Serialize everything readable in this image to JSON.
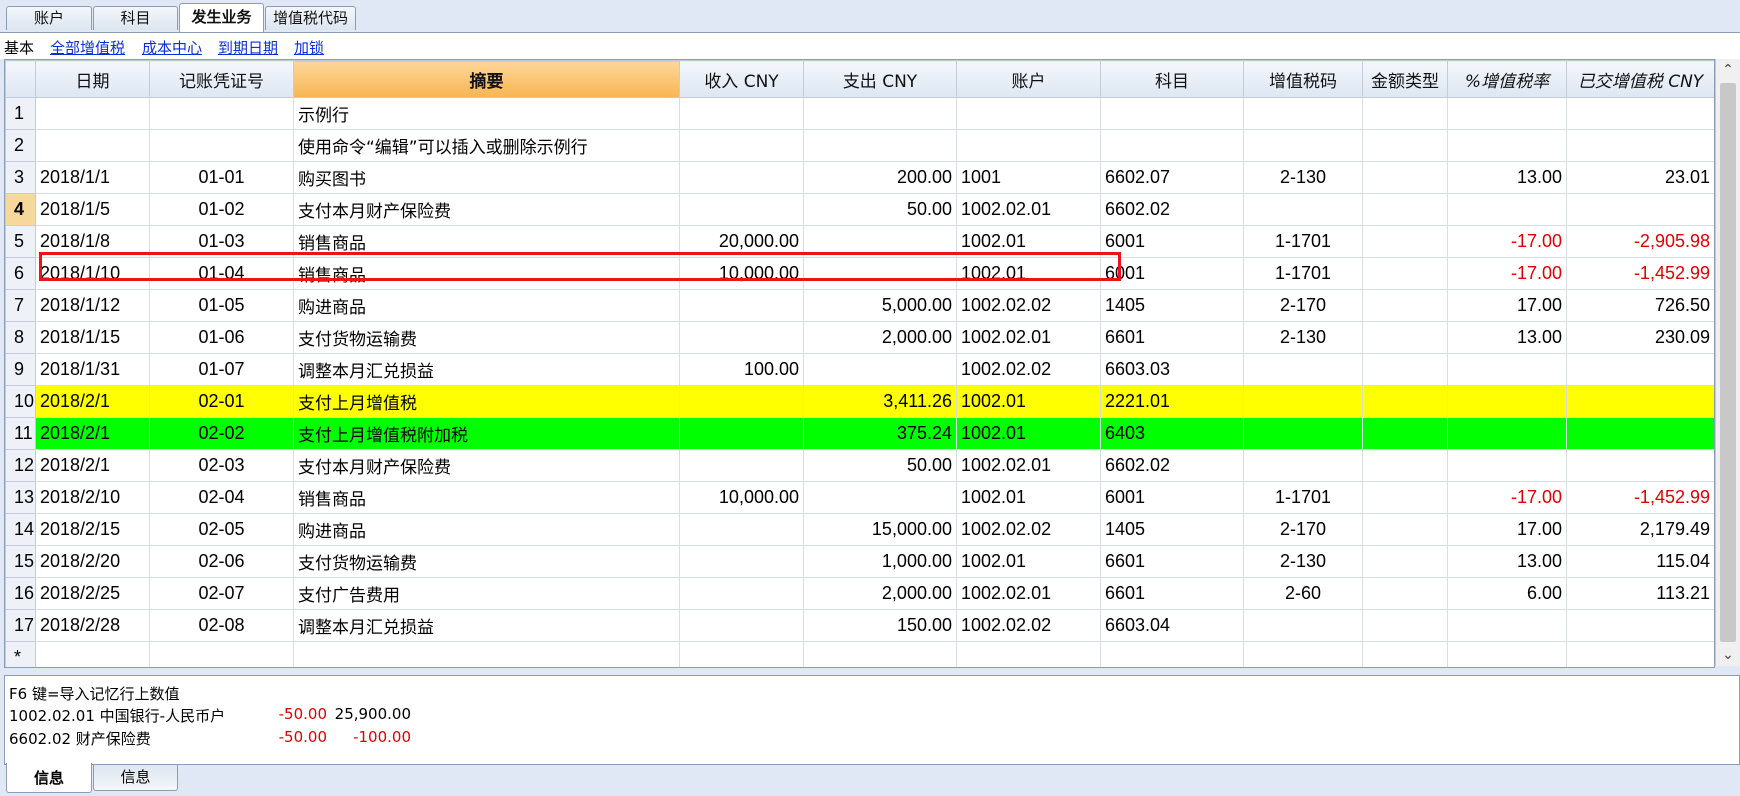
{
  "top_tabs": [
    "账户",
    "科目",
    "发生业务",
    "增值税代码"
  ],
  "views": [
    "基本",
    "全部增值税",
    "成本中心",
    "到期日期",
    "加锁"
  ],
  "columns": [
    "",
    "日期",
    "记账凭证号",
    "摘要",
    "收入 CNY",
    "支出 CNY",
    "账户",
    "科目",
    "增值税码",
    "金额类型",
    "%增值税率",
    "已交增值税 CNY"
  ],
  "rows": [
    {
      "n": "1",
      "date": "",
      "doc": "",
      "desc": "示例行",
      "income": "",
      "expense": "",
      "account": "",
      "subject": "",
      "vatcode": "",
      "amttype": "",
      "vatrate": "",
      "vatpaid": ""
    },
    {
      "n": "2",
      "date": "",
      "doc": "",
      "desc": "使用命令“编辑”可以插入或删除示例行",
      "income": "",
      "expense": "",
      "account": "",
      "subject": "",
      "vatcode": "",
      "amttype": "",
      "vatrate": "",
      "vatpaid": ""
    },
    {
      "n": "3",
      "date": "2018/1/1",
      "doc": "01-01",
      "desc": "购买图书",
      "income": "",
      "expense": "200.00",
      "account": "1001",
      "subject": "6602.07",
      "vatcode": "2-130",
      "amttype": "",
      "vatrate": "13.00",
      "vatpaid": "23.01"
    },
    {
      "n": "4",
      "date": "2018/1/5",
      "doc": "01-02",
      "desc": "支付本月财产保险费",
      "income": "",
      "expense": "50.00",
      "account": "1002.02.01",
      "subject": "6602.02",
      "vatcode": "",
      "amttype": "",
      "vatrate": "",
      "vatpaid": ""
    },
    {
      "n": "5",
      "date": "2018/1/8",
      "doc": "01-03",
      "desc": "销售商品",
      "income": "20,000.00",
      "expense": "",
      "account": "1002.01",
      "subject": "6001",
      "vatcode": "1-1701",
      "amttype": "",
      "vatrate": "-17.00",
      "vatpaid": "-2,905.98"
    },
    {
      "n": "6",
      "date": "2018/1/10",
      "doc": "01-04",
      "desc": "销售商品",
      "income": "10,000.00",
      "expense": "",
      "account": "1002.01",
      "subject": "6001",
      "vatcode": "1-1701",
      "amttype": "",
      "vatrate": "-17.00",
      "vatpaid": "-1,452.99"
    },
    {
      "n": "7",
      "date": "2018/1/12",
      "doc": "01-05",
      "desc": "购进商品",
      "income": "",
      "expense": "5,000.00",
      "account": "1002.02.02",
      "subject": "1405",
      "vatcode": "2-170",
      "amttype": "",
      "vatrate": "17.00",
      "vatpaid": "726.50"
    },
    {
      "n": "8",
      "date": "2018/1/15",
      "doc": "01-06",
      "desc": "支付货物运输费",
      "income": "",
      "expense": "2,000.00",
      "account": "1002.02.01",
      "subject": "6601",
      "vatcode": "2-130",
      "amttype": "",
      "vatrate": "13.00",
      "vatpaid": "230.09"
    },
    {
      "n": "9",
      "date": "2018/1/31",
      "doc": "01-07",
      "desc": "调整本月汇兑损益",
      "income": "100.00",
      "expense": "",
      "account": "1002.02.02",
      "subject": "6603.03",
      "vatcode": "",
      "amttype": "",
      "vatrate": "",
      "vatpaid": ""
    },
    {
      "n": "10",
      "date": "2018/2/1",
      "doc": "02-01",
      "desc": "支付上月增值税",
      "income": "",
      "expense": "3,411.26",
      "account": "1002.01",
      "subject": "2221.01",
      "vatcode": "",
      "amttype": "",
      "vatrate": "",
      "vatpaid": ""
    },
    {
      "n": "11",
      "date": "2018/2/1",
      "doc": "02-02",
      "desc": "支付上月增值税附加税",
      "income": "",
      "expense": "375.24",
      "account": "1002.01",
      "subject": "6403",
      "vatcode": "",
      "amttype": "",
      "vatrate": "",
      "vatpaid": ""
    },
    {
      "n": "12",
      "date": "2018/2/1",
      "doc": "02-03",
      "desc": "支付本月财产保险费",
      "income": "",
      "expense": "50.00",
      "account": "1002.02.01",
      "subject": "6602.02",
      "vatcode": "",
      "amttype": "",
      "vatrate": "",
      "vatpaid": ""
    },
    {
      "n": "13",
      "date": "2018/2/10",
      "doc": "02-04",
      "desc": "销售商品",
      "income": "10,000.00",
      "expense": "",
      "account": "1002.01",
      "subject": "6001",
      "vatcode": "1-1701",
      "amttype": "",
      "vatrate": "-17.00",
      "vatpaid": "-1,452.99"
    },
    {
      "n": "14",
      "date": "2018/2/15",
      "doc": "02-05",
      "desc": "购进商品",
      "income": "",
      "expense": "15,000.00",
      "account": "1002.02.02",
      "subject": "1405",
      "vatcode": "2-170",
      "amttype": "",
      "vatrate": "17.00",
      "vatpaid": "2,179.49"
    },
    {
      "n": "15",
      "date": "2018/2/20",
      "doc": "02-06",
      "desc": "支付货物运输费",
      "income": "",
      "expense": "1,000.00",
      "account": "1002.01",
      "subject": "6601",
      "vatcode": "2-130",
      "amttype": "",
      "vatrate": "13.00",
      "vatpaid": "115.04"
    },
    {
      "n": "16",
      "date": "2018/2/25",
      "doc": "02-07",
      "desc": "支付广告费用",
      "income": "",
      "expense": "2,000.00",
      "account": "1002.02.01",
      "subject": "6601",
      "vatcode": "2-60",
      "amttype": "",
      "vatrate": "6.00",
      "vatpaid": "113.21"
    },
    {
      "n": "17",
      "date": "2018/2/28",
      "doc": "02-08",
      "desc": "调整本月汇兑损益",
      "income": "",
      "expense": "150.00",
      "account": "1002.02.02",
      "subject": "6603.04",
      "vatcode": "",
      "amttype": "",
      "vatrate": "",
      "vatpaid": ""
    },
    {
      "n": "*",
      "date": "",
      "doc": "",
      "desc": "",
      "income": "",
      "expense": "",
      "account": "",
      "subject": "",
      "vatcode": "",
      "amttype": "",
      "vatrate": "",
      "vatpaid": ""
    }
  ],
  "info": {
    "hint": "F6 键=导入记忆行上数值",
    "lines": [
      {
        "label": "1002.02.01 中国银行-人民币户",
        "amount": "-50.00",
        "balance": "25,900.00"
      },
      {
        "label": "6602.02      财产保险费",
        "amount": "-50.00",
        "balance": "-100.00"
      }
    ]
  },
  "bottom_tabs": [
    "信息",
    "信息"
  ],
  "colors": {
    "highlight_yellow": "#ffff00",
    "highlight_green": "#00ff00",
    "negative": "#e00000",
    "selection_border": "#e8161b"
  }
}
